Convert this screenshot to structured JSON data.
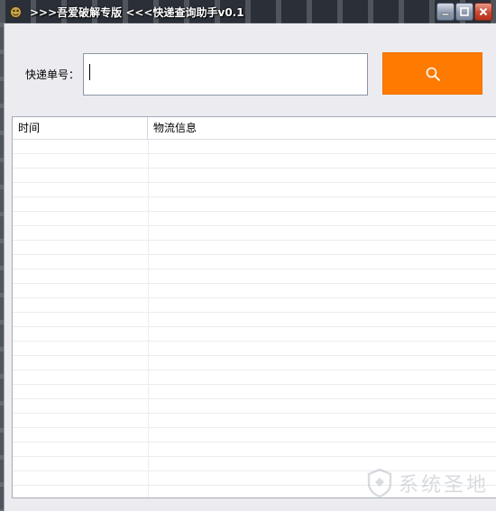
{
  "window": {
    "title": ">>>吾爱破解专版 <<<快递查询助手v0.1"
  },
  "search": {
    "label": "快递单号：",
    "value": "",
    "placeholder": "",
    "button_icon": "search-icon",
    "button_color": "#FF7A00"
  },
  "table": {
    "columns": [
      "时间",
      "物流信息"
    ],
    "rows": []
  },
  "watermark": {
    "text": "系统圣地"
  }
}
